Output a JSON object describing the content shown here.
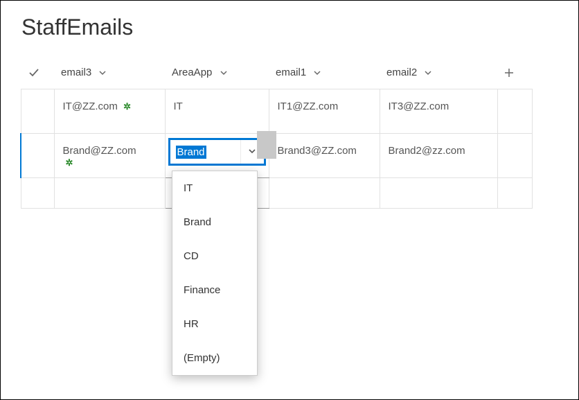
{
  "title": "StaffEmails",
  "columns": {
    "email3": "email3",
    "area": "AreaApp",
    "email1": "email1",
    "email2": "email2"
  },
  "rows": [
    {
      "email3": "IT@ZZ.com",
      "area": "IT",
      "email1": "IT1@ZZ.com",
      "email2": "IT3@ZZ.com"
    },
    {
      "email3": "Brand@ZZ.com",
      "area_editing": "Brand",
      "email1": "Brand3@ZZ.com",
      "email2": "Brand2@zz.com"
    }
  ],
  "dropdown": {
    "options": [
      "IT",
      "Brand",
      "CD",
      "Finance",
      "HR",
      "(Empty)"
    ]
  }
}
